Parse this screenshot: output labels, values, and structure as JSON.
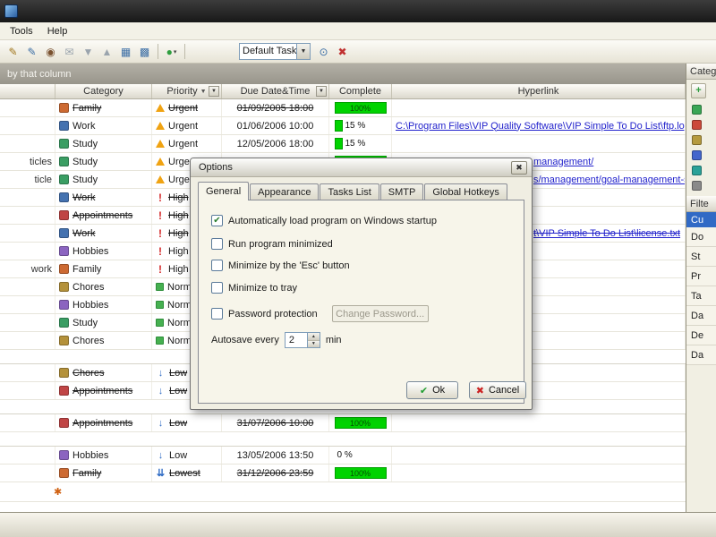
{
  "window": {
    "menu_items": [
      "Tools",
      "Help"
    ]
  },
  "toolbar": {
    "combo_value": "Default Task V",
    "buttons_before": [
      {
        "name": "new-task-icon",
        "glyph": "✎",
        "color": "#a0761c"
      },
      {
        "name": "edit-task-icon",
        "glyph": "✎",
        "color": "#3b6ea5"
      },
      {
        "name": "view-task-icon",
        "glyph": "◉",
        "color": "#7a5230"
      },
      {
        "name": "mail-icon",
        "glyph": "✉",
        "color": "#9aa4ad"
      },
      {
        "name": "import-icon",
        "glyph": "▼",
        "color": "#9aa4ad"
      },
      {
        "name": "export-icon",
        "glyph": "▲",
        "color": "#9aa4ad"
      },
      {
        "name": "grid-view-icon",
        "glyph": "▦",
        "color": "#3b6ea5"
      },
      {
        "name": "columns-icon",
        "glyph": "▩",
        "color": "#3b6ea5"
      }
    ],
    "sync_button": {
      "name": "sync-icon",
      "glyph": "●",
      "color": "#2f9e3f"
    },
    "buttons_after": [
      {
        "name": "find-icon",
        "glyph": "⊙",
        "color": "#3b6ea5"
      },
      {
        "name": "delete-task-icon",
        "glyph": "✖",
        "color": "#c03030"
      }
    ]
  },
  "group_strip": {
    "text": "by that column"
  },
  "table": {
    "headers": {
      "name": "",
      "category": "Category",
      "priority": "Priority",
      "due": "Due Date&Time",
      "complete": "Complete",
      "hyperlink": "Hyperlink"
    },
    "category_colors": {
      "Family": "#cd6a32",
      "Work": "#4472b0",
      "Study": "#3a9e63",
      "Appointments": "#c04545",
      "Hobbies": "#8b64c0",
      "Chores": "#b4913a"
    },
    "rows": [
      {
        "category": "Family",
        "priority": "Urgent",
        "due": "01/09/2005 18:00",
        "pct": 100,
        "struck": true
      },
      {
        "category": "Work",
        "priority": "Urgent",
        "due": "01/06/2006 10:00",
        "pct": 15,
        "link": "C:\\Program Files\\VIP Quality Software\\VIP Simple To Do List\\ftp.log"
      },
      {
        "category": "Study",
        "priority": "Urgent",
        "due": "12/05/2006 18:00",
        "pct": 15
      },
      {
        "name": "ticles",
        "category": "Study",
        "priority": "Urgent",
        "pct": 100,
        "link": "management/",
        "link_offset": true
      },
      {
        "name": "ticle",
        "category": "Study",
        "priority": "Urgent",
        "link": "s/management/goal-management-software",
        "link_offset": true
      },
      {
        "category": "Work",
        "priority": "High",
        "struck": true
      },
      {
        "category": "Appointments",
        "priority": "High",
        "struck": true
      },
      {
        "category": "Work",
        "priority": "High",
        "struck": true,
        "link": "t\\VIP Simple To Do List\\license.txt",
        "link_offset": true,
        "link_struck": true
      },
      {
        "category": "Hobbies",
        "priority": "High"
      },
      {
        "name": "work",
        "category": "Family",
        "priority": "High"
      },
      {
        "category": "Chores",
        "priority": "Normal"
      },
      {
        "category": "Hobbies",
        "priority": "Normal"
      },
      {
        "category": "Study",
        "priority": "Normal"
      },
      {
        "category": "Chores",
        "priority": "Normal"
      },
      {
        "spacer": true
      },
      {
        "category": "Chores",
        "priority": "Low",
        "struck": true
      },
      {
        "category": "Appointments",
        "priority": "Low",
        "struck": true
      },
      {
        "spacer": true
      },
      {
        "category": "Appointments",
        "priority": "Low",
        "due": "31/07/2006 10:00",
        "pct": 100,
        "struck": true
      },
      {
        "spacer": true
      },
      {
        "category": "Hobbies",
        "priority": "Low",
        "due": "13/05/2006 13:50",
        "pct": 0
      },
      {
        "category": "Family",
        "priority": "Lowest",
        "due": "31/12/2006 23:59",
        "pct": 100,
        "struck": true
      }
    ]
  },
  "dialog": {
    "title": "Options",
    "tabs": [
      "General",
      "Appearance",
      "Tasks List",
      "SMTP",
      "Global Hotkeys"
    ],
    "active_tab": "General",
    "checkboxes": [
      {
        "label": "Automatically load program on Windows startup",
        "checked": true
      },
      {
        "label": "Run program minimized",
        "checked": false
      },
      {
        "label": "Minimize by the 'Esc' button",
        "checked": false
      },
      {
        "label": "Minimize to tray",
        "checked": false
      },
      {
        "label": "Password protection",
        "checked": false,
        "button": "Change Password..."
      }
    ],
    "autosave": {
      "label": "Autosave every",
      "value": "2",
      "unit": "min"
    },
    "ok_label": "Ok",
    "cancel_label": "Cancel"
  },
  "right_panel": {
    "categories_caption": "Categ",
    "filter_caption": "Filte",
    "filter_selected": "Cu",
    "category_icon_colors": [
      "#3aa655",
      "#cc4a3a",
      "#b59a3f",
      "#4466cc",
      "#2aa198",
      "#8a8a8a"
    ],
    "filter_rows": [
      "Do",
      "St",
      "Pr",
      "Ta",
      "Da",
      "De",
      "Da"
    ]
  },
  "colors": {
    "progress_green": "#00d300",
    "link_blue": "#2222cc",
    "selection_blue": "#316ac5"
  }
}
